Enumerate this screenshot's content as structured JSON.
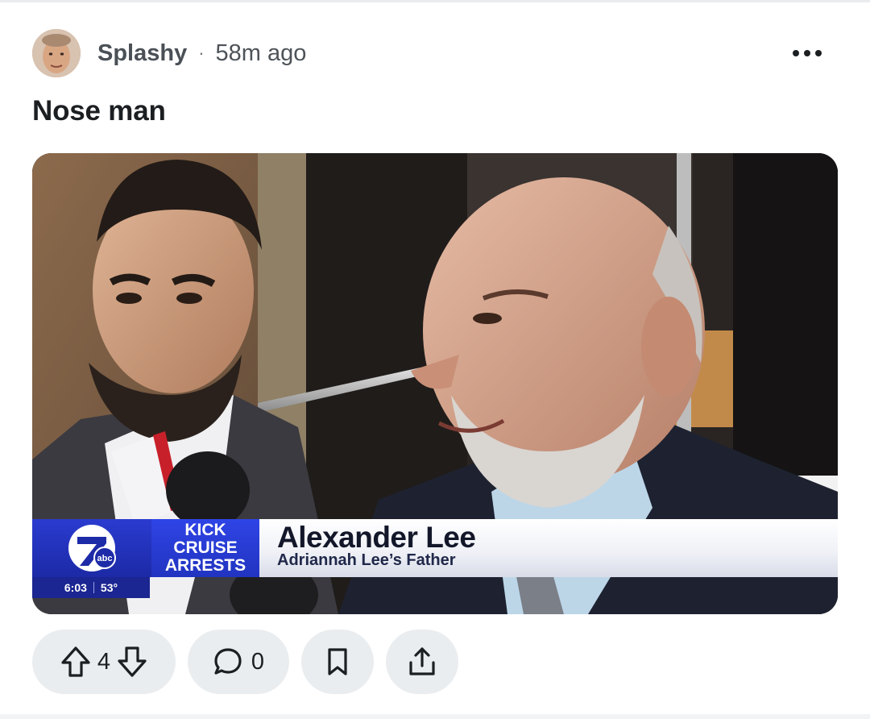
{
  "post": {
    "author": "Splashy",
    "separator": "·",
    "time_ago": "58m ago",
    "title": "Nose man"
  },
  "media": {
    "lower_third": {
      "tag_line1": "KICK",
      "tag_line2": "CRUISE",
      "tag_line3": "ARRESTS",
      "name": "Alexander Lee",
      "subtitle": "Adriannah Lee’s Father",
      "clock": "6:03",
      "temperature": "53°",
      "station_logo": "channel-7-abc-logo",
      "brand_color": "#2134c0"
    }
  },
  "actions": {
    "upvote_icon": "arrow-up-icon",
    "vote_count": "4",
    "downvote_icon": "arrow-down-icon",
    "comment_icon": "speech-bubble-icon",
    "comment_count": "0",
    "save_icon": "bookmark-icon",
    "share_icon": "share-icon"
  },
  "colors": {
    "pill_bg": "#eaedef",
    "text_primary": "#1c1f22"
  }
}
